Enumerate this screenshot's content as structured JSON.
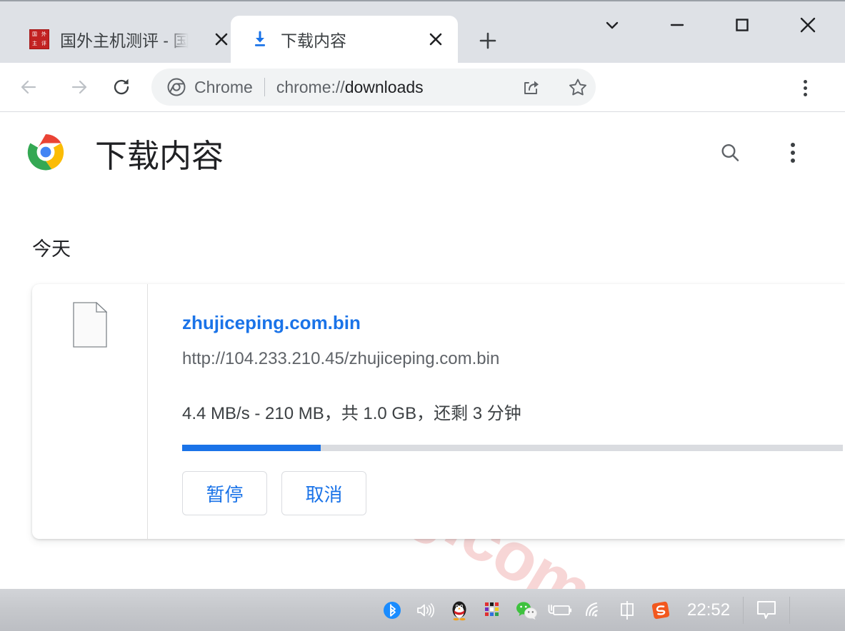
{
  "window": {
    "controls": {
      "tab_search": "tab-search-chevron",
      "minimize": "minimize",
      "maximize": "maximize",
      "close": "close"
    }
  },
  "tabstrip": {
    "tabs": [
      {
        "title": "国外主机测评 - 国",
        "favicon": "cn-site-favicon",
        "active": false,
        "close_label": "✕"
      },
      {
        "title": "下载内容",
        "favicon": "download-arrow-icon",
        "active": true,
        "close_label": "✕"
      }
    ],
    "new_tab_label": "+"
  },
  "toolbar": {
    "back_icon": "arrow-left-icon",
    "forward_icon": "arrow-right-icon",
    "reload_icon": "reload-icon",
    "omnibox": {
      "chrome_label": "Chrome",
      "url_scheme": "chrome://",
      "url_rest": "downloads",
      "share_icon": "share-icon",
      "bookmark_icon": "star-icon"
    },
    "menu_icon": "three-dot-menu-icon"
  },
  "page": {
    "title": "下载内容",
    "logo": "chrome-logo",
    "search_icon": "search-icon",
    "menu_icon": "three-dot-menu-icon",
    "watermark": "zhujiceping.com",
    "day_label": "今天",
    "download": {
      "file_icon": "generic-file-icon",
      "filename": "zhujiceping.com.bin",
      "url": "http://104.233.210.45/zhujiceping.com.bin",
      "status": "4.4 MB/s - 210 MB，共 1.0 GB，还剩 3 分钟",
      "progress_percent": 21,
      "pause_label": "暂停",
      "cancel_label": "取消"
    }
  },
  "taskbar": {
    "tray_icons": [
      "bluetooth-icon",
      "volume-icon",
      "qq-penguin-icon",
      "color-grid-icon",
      "wechat-icon",
      "battery-charging-icon",
      "wifi-icon",
      "ime-chinese-icon",
      "sogou-icon"
    ],
    "clock": "22:52",
    "notification_icon": "notification-bubble-icon"
  },
  "colors": {
    "accent_blue": "#1a73e8",
    "tabstrip_bg": "#dee1e6",
    "omnibox_bg": "#f1f3f4",
    "watermark_pink": "#f6cfcf",
    "taskbar_gray": "#c6c8cc"
  }
}
